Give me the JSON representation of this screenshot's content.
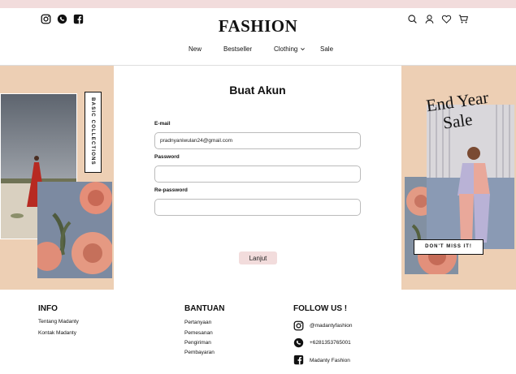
{
  "brand": "FASHION",
  "nav": {
    "items": [
      "New",
      "Bestseller",
      "Clothing",
      "Sale"
    ]
  },
  "left": {
    "tag": "BASIC COLLECTIONS"
  },
  "form": {
    "title": "Buat Akun",
    "email_label": "E-mail",
    "email_value": "pradnyaniwulan24@gmail.com",
    "password_label": "Password",
    "repassword_label": "Re-password",
    "submit_label": "Lanjut"
  },
  "promo": {
    "headline_1": "End Year",
    "headline_2": "Sale",
    "cta": "DON'T MISS IT!"
  },
  "footer": {
    "info": {
      "title": "INFO",
      "links": [
        "Tentang Madanty",
        "Kontak Madanty"
      ]
    },
    "bantuan": {
      "title": "BANTUAN",
      "links": [
        "Pertanyaan",
        "Pemesanan",
        "Pengiriman",
        "Pembayaran"
      ]
    },
    "follow": {
      "title": "FOLLOW US !",
      "instagram": "@madantyfashion",
      "whatsapp": "+6281353765001",
      "facebook": "Madanty Fashion"
    }
  },
  "colors": {
    "accent_pink": "#f2dcdc",
    "peach": "#edcfb4"
  },
  "icons": [
    "instagram-icon",
    "whatsapp-icon",
    "facebook-icon",
    "search-icon",
    "user-icon",
    "heart-icon",
    "cart-icon",
    "chevron-down-icon"
  ]
}
